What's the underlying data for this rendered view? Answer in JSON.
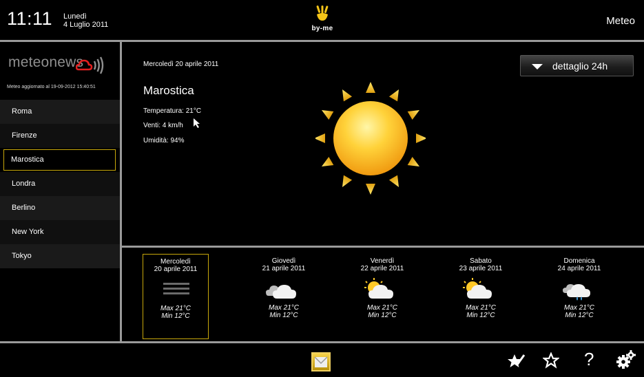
{
  "header": {
    "time": "11:11",
    "day_name": "Lunedì",
    "date": "4 Luglio 2011",
    "logo_text": "by-me",
    "app_title": "Meteo"
  },
  "sidebar": {
    "brand": "meteonews",
    "updated": "Meteo aggiornato al 19-09-2012 15:40:51",
    "cities": [
      "Roma",
      "Firenze",
      "Marostica",
      "Londra",
      "Berlino",
      "New York",
      "Tokyo"
    ],
    "selected_city": "Marostica"
  },
  "detail": {
    "date": "Mercoledì 20 aprile 2011",
    "city": "Marostica",
    "temperature": "Temperatura:  21°C",
    "wind": "Venti:  4 km/h",
    "humidity": "Umidità: 94%",
    "detail_button": "dettaglio 24h",
    "condition_icon": "sun-icon"
  },
  "forecast": [
    {
      "day": "Mercoledì",
      "date": "20 aprile 2011",
      "max": "Max 21°C",
      "min": "Min 12°C",
      "icon": "fog-icon",
      "selected": true
    },
    {
      "day": "Giovedì",
      "date": "21 aprile 2011",
      "max": "Max 21°C",
      "min": "Min 12°C",
      "icon": "cloudy-icon",
      "selected": false
    },
    {
      "day": "Venerdì",
      "date": "22 aprile 2011",
      "max": "Max 21°C",
      "min": "Min 12°C",
      "icon": "partly-cloudy-icon",
      "selected": false
    },
    {
      "day": "Sabato",
      "date": "23 aprile 2011",
      "max": "Max 21°C",
      "min": "Min 12°C",
      "icon": "partly-cloudy-icon",
      "selected": false
    },
    {
      "day": "Domenica",
      "date": "24 aprile 2011",
      "max": "Max 21°C",
      "min": "Min 12°C",
      "icon": "rain-icon",
      "selected": false
    }
  ],
  "footer": {
    "help_label": "?",
    "icons": [
      "checkmark-icon",
      "favorite-add-icon",
      "favorite-icon",
      "help-icon",
      "settings-icon"
    ]
  },
  "colors": {
    "accent": "#c8a80a",
    "separator": "#9a9a9a",
    "background": "#000000"
  }
}
